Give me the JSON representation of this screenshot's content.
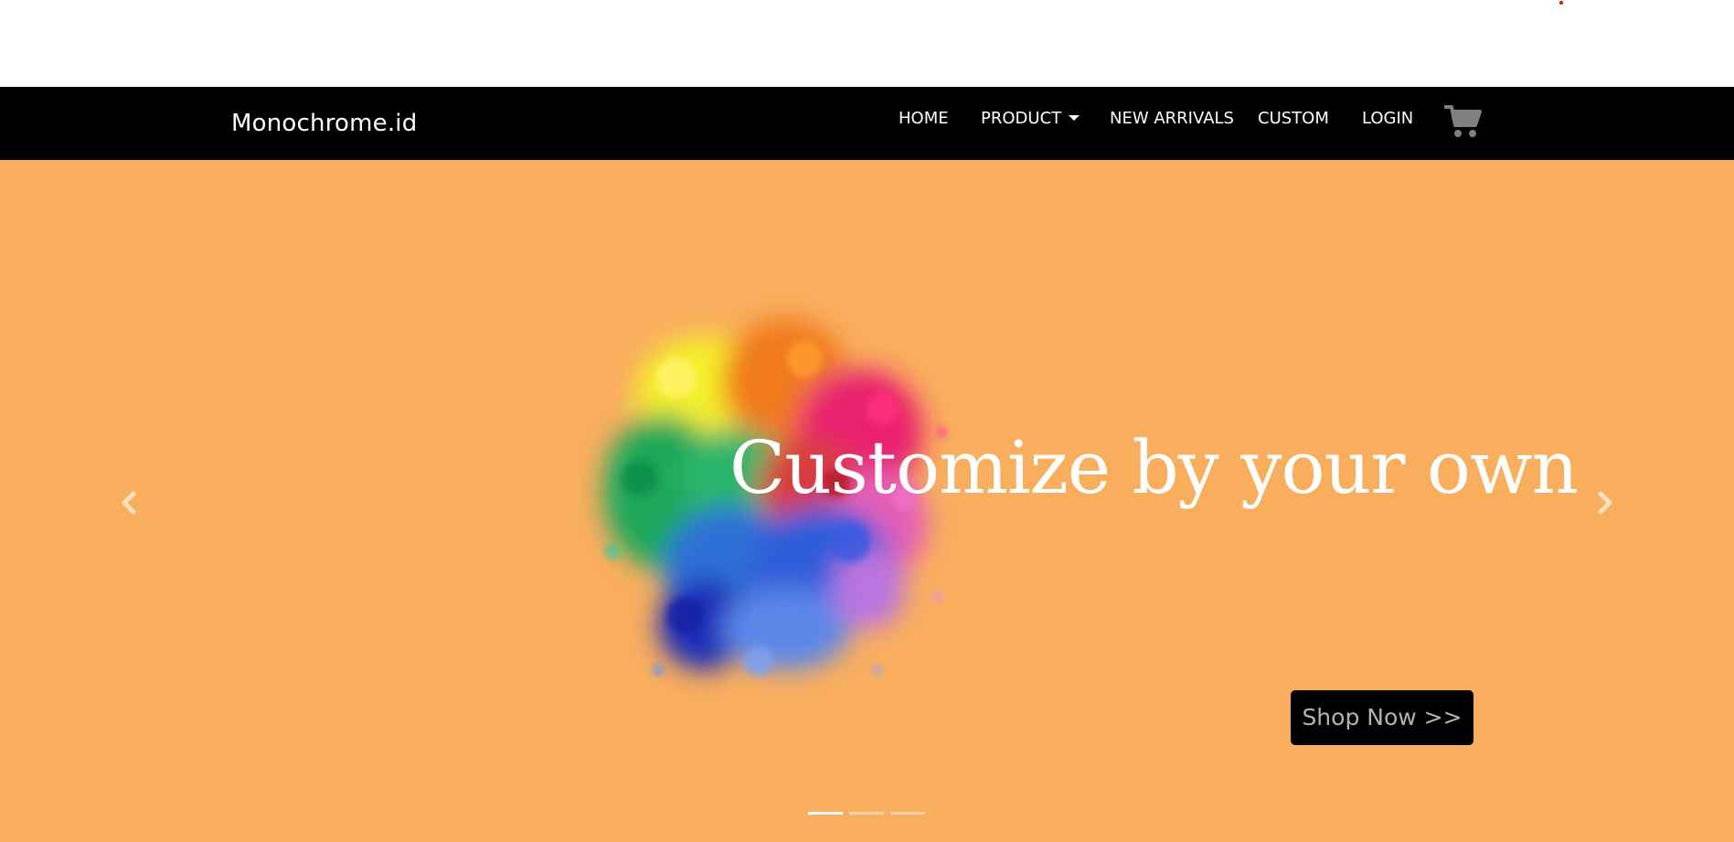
{
  "colors": {
    "navbar_bg": "#000000",
    "hero_bg": "#f9ae5e",
    "button_bg": "#000000",
    "accent_dot": "#cc1b1b",
    "cart_icon": "#808080",
    "indicator_active": "#ffffff",
    "indicator_inactive": "#fcd4a8"
  },
  "navbar": {
    "brand": "Monochrome.id",
    "items": [
      {
        "label": "HOME",
        "dropdown": false
      },
      {
        "label": "PRODUCT",
        "dropdown": true
      },
      {
        "label": "NEW ARRIVALS",
        "dropdown": false
      },
      {
        "label": "CUSTOM",
        "dropdown": false
      },
      {
        "label": "LOGIN",
        "dropdown": false
      }
    ],
    "cart_icon": "shopping-cart-icon"
  },
  "carousel": {
    "headline": "Customize by your own",
    "button_label": "Shop Now >>",
    "prev_icon": "chevron-left-icon",
    "next_icon": "chevron-right-icon",
    "slide_count": 3,
    "active_slide": 1,
    "image": "paint-splash-image"
  }
}
